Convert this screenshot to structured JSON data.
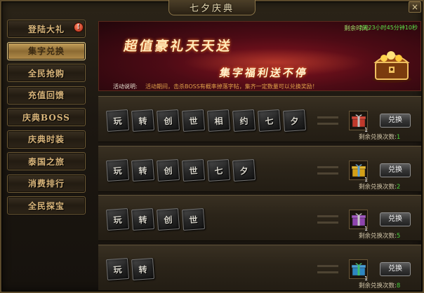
{
  "window": {
    "title": "七夕庆典",
    "close_label": "×"
  },
  "sidebar": {
    "items": [
      {
        "label": "登陆大礼",
        "active": false,
        "alert": "!"
      },
      {
        "label": "集字兑换",
        "active": true
      },
      {
        "label": "全民抢购",
        "active": false
      },
      {
        "label": "充值回馈",
        "active": false
      },
      {
        "label": "庆典BOSS",
        "active": false
      },
      {
        "label": "庆典时装",
        "active": false
      },
      {
        "label": "泰国之旅",
        "active": false
      },
      {
        "label": "消费排行",
        "active": false
      },
      {
        "label": "全民探宝",
        "active": false
      }
    ]
  },
  "banner": {
    "time_label": "剩余时间:",
    "time_value": "2天23小时45分钟10秒",
    "title_main": "超值豪礼天天送",
    "title_sub": "集字福利送不停",
    "desc_label": "活动说明:",
    "desc_text": "活动期间，击杀BOSS有概率掉落字帖，集齐一定数量可以兑换奖励！",
    "colors": {
      "time": "#5ce54a",
      "desc": "#e0a04a"
    }
  },
  "rows": [
    {
      "tiles": [
        "玩",
        "转",
        "创",
        "世",
        "相",
        "约",
        "七",
        "夕"
      ],
      "gift_color": "#c0392b",
      "gift_count": "1",
      "button": "兑换",
      "remain_label": "剩余兑换次数:",
      "remain_value": "1"
    },
    {
      "tiles": [
        "玩",
        "转",
        "创",
        "世",
        "七",
        "夕"
      ],
      "gift_color": "#d4a017",
      "gift_count": "1",
      "button": "兑换",
      "remain_label": "剩余兑换次数:",
      "remain_value": "2"
    },
    {
      "tiles": [
        "玩",
        "转",
        "创",
        "世"
      ],
      "gift_color": "#8e44ad",
      "gift_count": "1",
      "button": "兑换",
      "remain_label": "剩余兑换次数:",
      "remain_value": "5"
    },
    {
      "tiles": [
        "玩",
        "转"
      ],
      "gift_color": "#2e86c1",
      "gift_count": "1",
      "button": "兑换",
      "remain_label": "剩余兑换次数:",
      "remain_value": "8"
    }
  ]
}
